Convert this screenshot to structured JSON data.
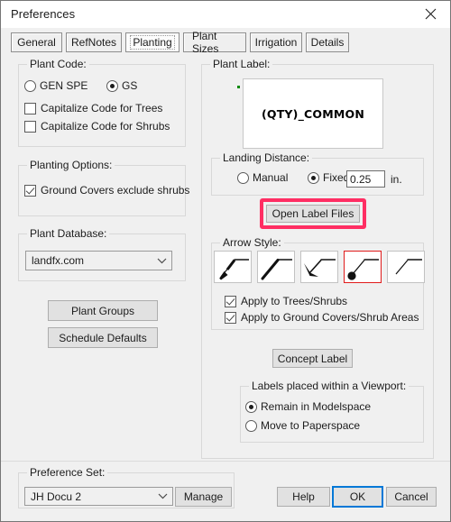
{
  "window": {
    "title": "Preferences",
    "close_icon": "close-icon"
  },
  "tabs": [
    {
      "label": "General",
      "selected": false
    },
    {
      "label": "RefNotes",
      "selected": false
    },
    {
      "label": "Planting",
      "selected": true
    },
    {
      "label": "Plant Sizes",
      "selected": false
    },
    {
      "label": "Irrigation",
      "selected": false
    },
    {
      "label": "Details",
      "selected": false
    }
  ],
  "plant_code": {
    "title": "Plant Code:",
    "radios": [
      {
        "label": "GEN SPE",
        "checked": false
      },
      {
        "label": "GS",
        "checked": true
      }
    ],
    "checkboxes": [
      {
        "label": "Capitalize Code for Trees",
        "checked": false
      },
      {
        "label": "Capitalize Code for Shrubs",
        "checked": false
      }
    ]
  },
  "planting_options": {
    "title": "Planting Options:",
    "checkboxes": [
      {
        "label": "Ground Covers exclude shrubs",
        "checked": true
      }
    ]
  },
  "plant_database": {
    "title": "Plant Database:",
    "value": "landfx.com"
  },
  "left_buttons": [
    {
      "label": "Plant Groups"
    },
    {
      "label": "Schedule Defaults"
    }
  ],
  "plant_label": {
    "title": "Plant Label:",
    "preview_text": "(QTY)_COMMON",
    "preview_dot_color": "#0a8a0a",
    "landing_distance": {
      "title": "Landing Distance:",
      "radios": [
        {
          "label": "Manual",
          "checked": false
        },
        {
          "label": "Fixed:",
          "checked": true
        }
      ],
      "fixed_value": "0.25",
      "units": "in."
    },
    "open_label_files": {
      "label": "Open Label Files",
      "highlight_color": "#ff2e63"
    },
    "arrow_style": {
      "title": "Arrow Style:",
      "selected_index": 3,
      "selected_border_color": "#e01b1b",
      "options": [
        {
          "name": "arrow-style-filled-taper-icon"
        },
        {
          "name": "arrow-style-thin-taper-icon"
        },
        {
          "name": "arrow-style-hooked-barb-icon"
        },
        {
          "name": "arrow-style-dot-terminator-icon"
        },
        {
          "name": "arrow-style-plain-line-icon"
        }
      ],
      "checkboxes": [
        {
          "label": "Apply to Trees/Shrubs",
          "checked": true
        },
        {
          "label": "Apply to Ground Covers/Shrub Areas",
          "checked": true
        }
      ]
    },
    "concept_label_button": "Concept Label",
    "viewport": {
      "title": "Labels placed within a Viewport:",
      "radios": [
        {
          "label": "Remain in Modelspace",
          "checked": true
        },
        {
          "label": "Move to Paperspace",
          "checked": false
        }
      ]
    }
  },
  "footer": {
    "preference_set": {
      "title": "Preference Set:",
      "value": "JH Docu 2"
    },
    "manage_label": "Manage",
    "help_label": "Help",
    "ok_label": "OK",
    "cancel_label": "Cancel",
    "focus_color": "#0078d7"
  }
}
